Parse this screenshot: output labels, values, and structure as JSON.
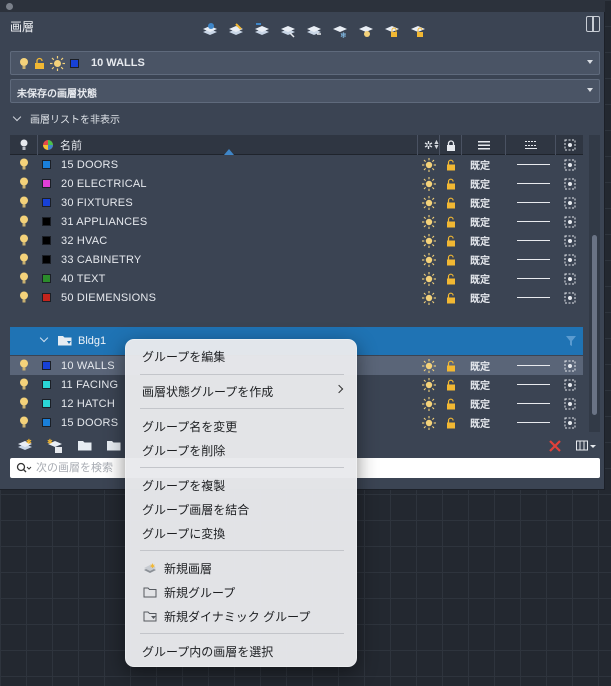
{
  "app": {
    "title": "画層"
  },
  "current_layer": {
    "name": "10 WALLS",
    "color": "#1741d6"
  },
  "layer_state": {
    "value": "未保存の画層状態"
  },
  "list_toggle": {
    "label": "画層リストを非表示"
  },
  "columns": {
    "name": "名前"
  },
  "layers": [
    {
      "name": "15 DOORS",
      "color": "#1a7fd9",
      "linetype": "既定"
    },
    {
      "name": "20 ELECTRICAL",
      "color": "#e13fd8",
      "linetype": "既定"
    },
    {
      "name": "30 FIXTURES",
      "color": "#1741d6",
      "linetype": "既定"
    },
    {
      "name": "31 APPLIANCES",
      "color": "#000000",
      "linetype": "既定"
    },
    {
      "name": "32 HVAC",
      "color": "#000000",
      "linetype": "既定"
    },
    {
      "name": "33 CABINETRY",
      "color": "#000000",
      "linetype": "既定"
    },
    {
      "name": "40 TEXT",
      "color": "#2b8c2b",
      "linetype": "既定"
    },
    {
      "name": "50 DIEMENSIONS",
      "color": "#c4241c",
      "linetype": "既定"
    }
  ],
  "group": {
    "name": "Bldg1"
  },
  "group_layers": [
    {
      "name": "10 WALLS",
      "color": "#1741d6",
      "linetype": "既定",
      "selected": true
    },
    {
      "name": "11 FACING",
      "color": "#2ad6d6",
      "linetype": "既定"
    },
    {
      "name": "12 HATCH",
      "color": "#2ad6d6",
      "linetype": "既定"
    },
    {
      "name": "15 DOORS",
      "color": "#1a7fd9",
      "linetype": "既定"
    }
  ],
  "search": {
    "placeholder": "次の画層を検索"
  },
  "context_menu": {
    "edit_group": "グループを編集",
    "create_state_group": "画層状態グループを作成",
    "rename_group": "グループ名を変更",
    "delete_group": "グループを削除",
    "duplicate_group": "グループを複製",
    "merge_group_layers": "グループ画層を結合",
    "convert_to_group": "グループに変換",
    "new_layer": "新規画層",
    "new_group": "新規グループ",
    "new_dynamic_group": "新規ダイナミック グループ",
    "select_layers_in_group": "グループ内の画層を選択"
  },
  "colors": {
    "accent": "#1f73b4",
    "panel": "#3b4453",
    "bulb": "#f4d27a",
    "lock": "#f2b833",
    "close_red": "#e0413a"
  }
}
